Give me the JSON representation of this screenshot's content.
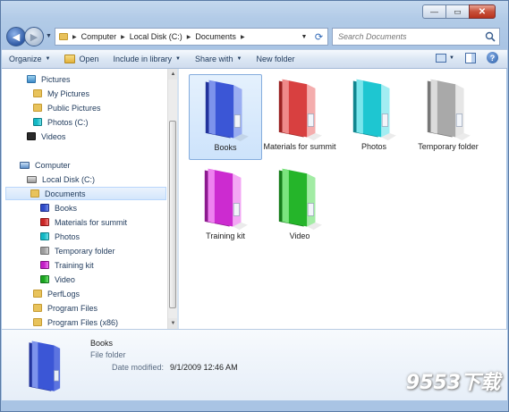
{
  "window": {
    "minimize_symbol": "—",
    "maximize_symbol": "▭",
    "close_symbol": "✕"
  },
  "nav": {
    "back_symbol": "◀",
    "forward_symbol": "▶",
    "history_symbol": "▼",
    "refresh_symbol": "⟳",
    "address": [
      {
        "label": "Computer"
      },
      {
        "label": "Local Disk (C:)"
      },
      {
        "label": "Documents"
      }
    ],
    "search_placeholder": "Search Documents"
  },
  "toolbar": {
    "organize": "Organize",
    "open": "Open",
    "include_in_library": "Include in library",
    "share_with": "Share with",
    "new_folder": "New folder",
    "help_symbol": "?"
  },
  "tree": [
    {
      "label": "Pictures",
      "icon": "pictures-library-icon",
      "color": "pics"
    },
    {
      "label": "My Pictures",
      "icon": "folder-icon",
      "color": "plain"
    },
    {
      "label": "Public Pictures",
      "icon": "folder-icon",
      "color": "plain"
    },
    {
      "label": "Photos (C:)",
      "icon": "folder-icon",
      "color": "cyan"
    },
    {
      "label": "Videos",
      "icon": "videos-library-icon",
      "color": "videos"
    },
    {
      "label": "Computer",
      "icon": "computer-icon",
      "color": "computer"
    },
    {
      "label": "Local Disk (C:)",
      "icon": "disk-icon",
      "color": "disk"
    },
    {
      "label": "Documents",
      "icon": "folder-icon",
      "color": "plain",
      "selected": true
    },
    {
      "label": "Books",
      "icon": "folder-icon",
      "color": "blue"
    },
    {
      "label": "Materials for summit",
      "icon": "folder-icon",
      "color": "red"
    },
    {
      "label": "Photos",
      "icon": "folder-icon",
      "color": "cyan"
    },
    {
      "label": "Temporary folder",
      "icon": "folder-icon",
      "color": "gray"
    },
    {
      "label": "Training kit",
      "icon": "folder-icon",
      "color": "magenta"
    },
    {
      "label": "Video",
      "icon": "folder-icon",
      "color": "green"
    },
    {
      "label": "PerfLogs",
      "icon": "folder-icon",
      "color": "plain"
    },
    {
      "label": "Program Files",
      "icon": "folder-icon",
      "color": "plain"
    },
    {
      "label": "Program Files (x86)",
      "icon": "folder-icon",
      "color": "plain"
    }
  ],
  "folders": [
    {
      "label": "Books",
      "color": "#3b56d6",
      "light": "#7d93ec",
      "dark": "#22339b",
      "selected": true
    },
    {
      "label": "Materials for summit",
      "color": "#d84040",
      "light": "#ef8a8a",
      "dark": "#9b2222"
    },
    {
      "label": "Photos",
      "color": "#1ec6d1",
      "light": "#7ae6ec",
      "dark": "#11868f"
    },
    {
      "label": "Temporary folder",
      "color": "#a9a9a9",
      "light": "#dcdcdc",
      "dark": "#777777"
    },
    {
      "label": "Training kit",
      "color": "#cc2bd0",
      "light": "#ee82f0",
      "dark": "#8c1a8f"
    },
    {
      "label": "Video",
      "color": "#25b52a",
      "light": "#7be47e",
      "dark": "#157d1a"
    }
  ],
  "details": {
    "name": "Books",
    "type": "File folder",
    "date_label": "Date modified:",
    "date_value": "9/1/2009 12:46 AM"
  },
  "watermark": "9553下载"
}
